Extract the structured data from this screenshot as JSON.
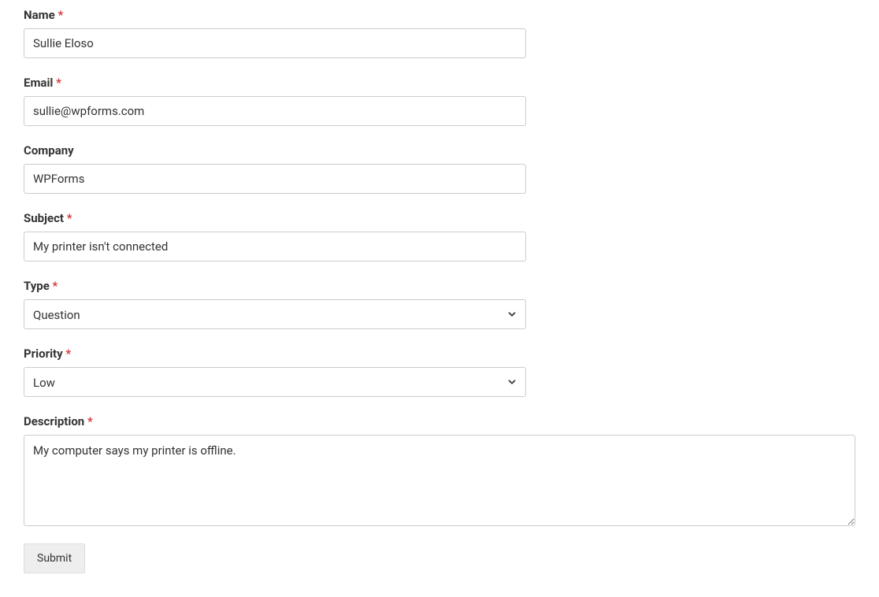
{
  "form": {
    "name": {
      "label": "Name",
      "required": true,
      "value": "Sullie Eloso"
    },
    "email": {
      "label": "Email",
      "required": true,
      "value": "sullie@wpforms.com"
    },
    "company": {
      "label": "Company",
      "required": false,
      "value": "WPForms"
    },
    "subject": {
      "label": "Subject",
      "required": true,
      "value": "My printer isn't connected"
    },
    "type": {
      "label": "Type",
      "required": true,
      "selected": "Question"
    },
    "priority": {
      "label": "Priority",
      "required": true,
      "selected": "Low"
    },
    "description": {
      "label": "Description",
      "required": true,
      "value": "My computer says my printer is offline."
    },
    "submit_label": "Submit",
    "required_marker": "*"
  }
}
